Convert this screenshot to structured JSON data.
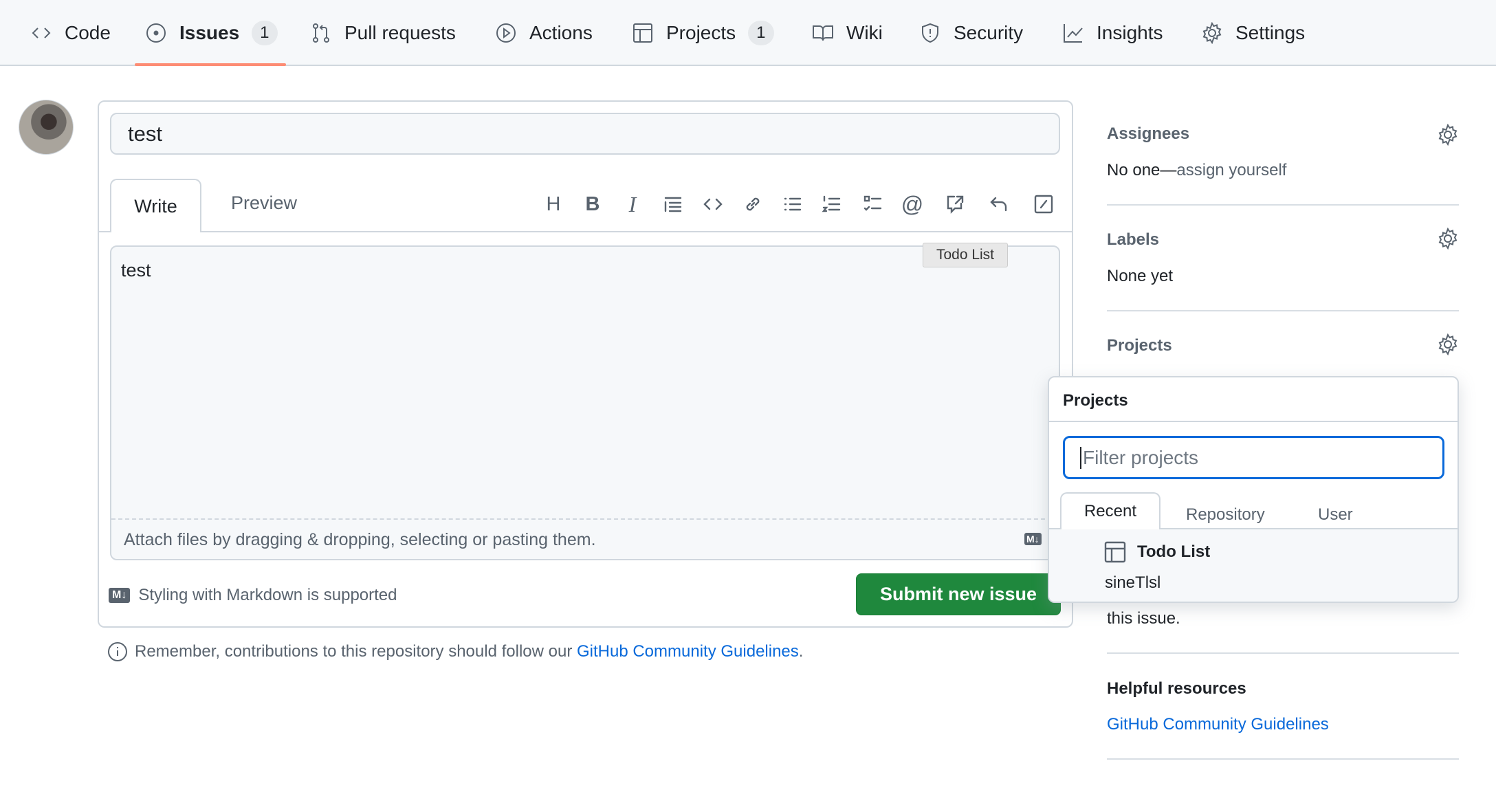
{
  "nav": {
    "items": [
      {
        "label": "Code",
        "icon": "code-icon"
      },
      {
        "label": "Issues",
        "icon": "issue-opened-icon",
        "count": "1",
        "active": true
      },
      {
        "label": "Pull requests",
        "icon": "git-pull-request-icon"
      },
      {
        "label": "Actions",
        "icon": "play-icon"
      },
      {
        "label": "Projects",
        "icon": "table-icon",
        "count": "1"
      },
      {
        "label": "Wiki",
        "icon": "book-icon"
      },
      {
        "label": "Security",
        "icon": "shield-icon"
      },
      {
        "label": "Insights",
        "icon": "graph-icon"
      },
      {
        "label": "Settings",
        "icon": "gear-icon"
      }
    ],
    "active_underline_color": "#fd8c73"
  },
  "issue": {
    "title_value": "test",
    "tabs": {
      "write": "Write",
      "preview": "Preview"
    },
    "toolbar": [
      "heading",
      "bold",
      "italic",
      "quote",
      "code",
      "link",
      "unordered-list",
      "ordered-list",
      "task-list",
      "mention",
      "reference",
      "undo",
      "slash-commands"
    ],
    "body_value": "test",
    "tooltip": "Todo List",
    "attach_text": "Attach files by dragging & dropping, selecting or pasting them.",
    "markdown_note": "Styling with Markdown is supported",
    "md_badge": "M↓",
    "submit_label": "Submit new issue",
    "submit_color": "#1f883d",
    "remember_text": "Remember, contributions to this repository should follow our ",
    "remember_link": "GitHub Community Guidelines",
    "remember_end": "."
  },
  "sidebar": {
    "assignees": {
      "heading": "Assignees",
      "text_prefix": "No one—",
      "link": "assign yourself"
    },
    "labels": {
      "heading": "Labels",
      "text": "None yet"
    },
    "projects": {
      "heading": "Projects"
    },
    "partial_text": "this issue.",
    "helpful": {
      "heading": "Helpful resources",
      "link": "GitHub Community Guidelines"
    }
  },
  "projects_dropdown": {
    "title": "Projects",
    "filter_placeholder": "Filter projects",
    "tabs": [
      "Recent",
      "Repository",
      "User"
    ],
    "items": [
      {
        "name": "Todo List",
        "owner": "sineTlsl"
      }
    ]
  }
}
